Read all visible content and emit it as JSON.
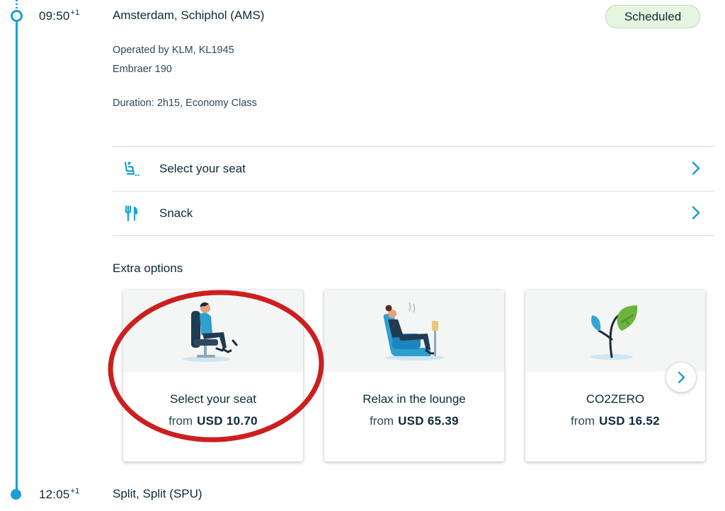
{
  "departure": {
    "time": "09:50",
    "day_offset": "+1",
    "airport": "Amsterdam, Schiphol (AMS)",
    "status": "Scheduled"
  },
  "flight": {
    "operated_by": "Operated by KLM, KL1945",
    "aircraft": "Embraer 190",
    "duration": "Duration: 2h15, Economy Class"
  },
  "services": [
    {
      "label": "Select your seat",
      "icon": "seat-icon"
    },
    {
      "label": "Snack",
      "icon": "fork-knife-icon"
    }
  ],
  "extra_options": {
    "title": "Extra options",
    "cards": [
      {
        "title": "Select your seat",
        "from": "from",
        "price": "USD 10.70",
        "icon": "seat-illustration"
      },
      {
        "title": "Relax in the lounge",
        "from": "from",
        "price": "USD 65.39",
        "icon": "lounge-illustration"
      },
      {
        "title": "CO2ZERO",
        "from": "from",
        "price": "USD 16.52",
        "icon": "leaf-plane-illustration"
      }
    ]
  },
  "arrival": {
    "time": "12:05",
    "day_offset": "+1",
    "airport": "Split, Split (SPU)"
  },
  "colors": {
    "accent": "#1a9fd8",
    "status_bg": "#e6f5e0",
    "status_border": "#b7dfa9",
    "annotation_red": "#cc1f1f"
  }
}
